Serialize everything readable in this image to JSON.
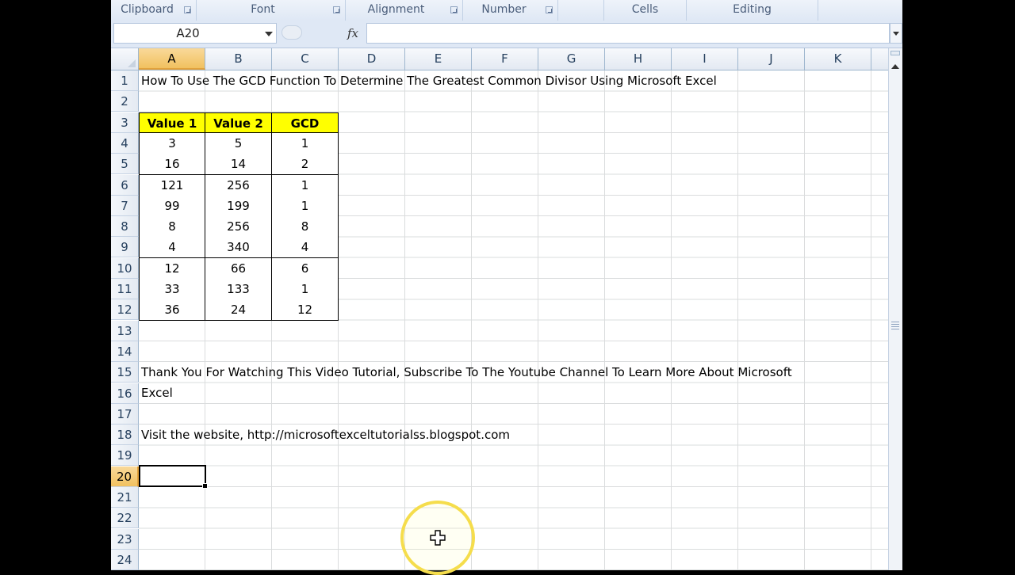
{
  "ribbon": {
    "groups": [
      {
        "label": "Clipboard"
      },
      {
        "label": "Font"
      },
      {
        "label": "Alignment"
      },
      {
        "label": "Number"
      },
      {
        "label": "Cells"
      },
      {
        "label": "Editing"
      }
    ]
  },
  "formula_bar": {
    "name_box": "A20",
    "fx_label": "fx",
    "formula": ""
  },
  "columns": [
    "A",
    "B",
    "C",
    "D",
    "E",
    "F",
    "G",
    "H",
    "I",
    "J",
    "K"
  ],
  "rows": [
    "1",
    "2",
    "3",
    "4",
    "5",
    "6",
    "7",
    "8",
    "9",
    "10",
    "11",
    "12",
    "13",
    "14",
    "15",
    "16",
    "17",
    "18",
    "19",
    "20",
    "21",
    "22",
    "23",
    "24"
  ],
  "selected_cell": {
    "column": "A",
    "row": "20"
  },
  "sheet": {
    "title": "How To Use The GCD Function To Determine The Greatest Common Divisor Using Microsoft Excel",
    "table": {
      "headers": [
        "Value 1",
        "Value 2",
        "GCD"
      ],
      "rows": [
        [
          "3",
          "5",
          "1"
        ],
        [
          "16",
          "14",
          "2"
        ],
        [
          "121",
          "256",
          "1"
        ],
        [
          "99",
          "199",
          "1"
        ],
        [
          "8",
          "256",
          "8"
        ],
        [
          "4",
          "340",
          "4"
        ],
        [
          "12",
          "66",
          "6"
        ],
        [
          "33",
          "133",
          "1"
        ],
        [
          "36",
          "24",
          "12"
        ]
      ]
    },
    "thanks_line1": "Thank You For Watching This Video Tutorial, Subscribe To The Youtube Channel To Learn More About Microsoft",
    "thanks_line2": "Excel",
    "website": "Visit the website, http://microsoftexceltutorialss.blogspot.com"
  },
  "colors": {
    "header_fill": "#ffff00",
    "selection_header": "#f1c15f",
    "cursor_highlight": "#f5dd4c"
  }
}
